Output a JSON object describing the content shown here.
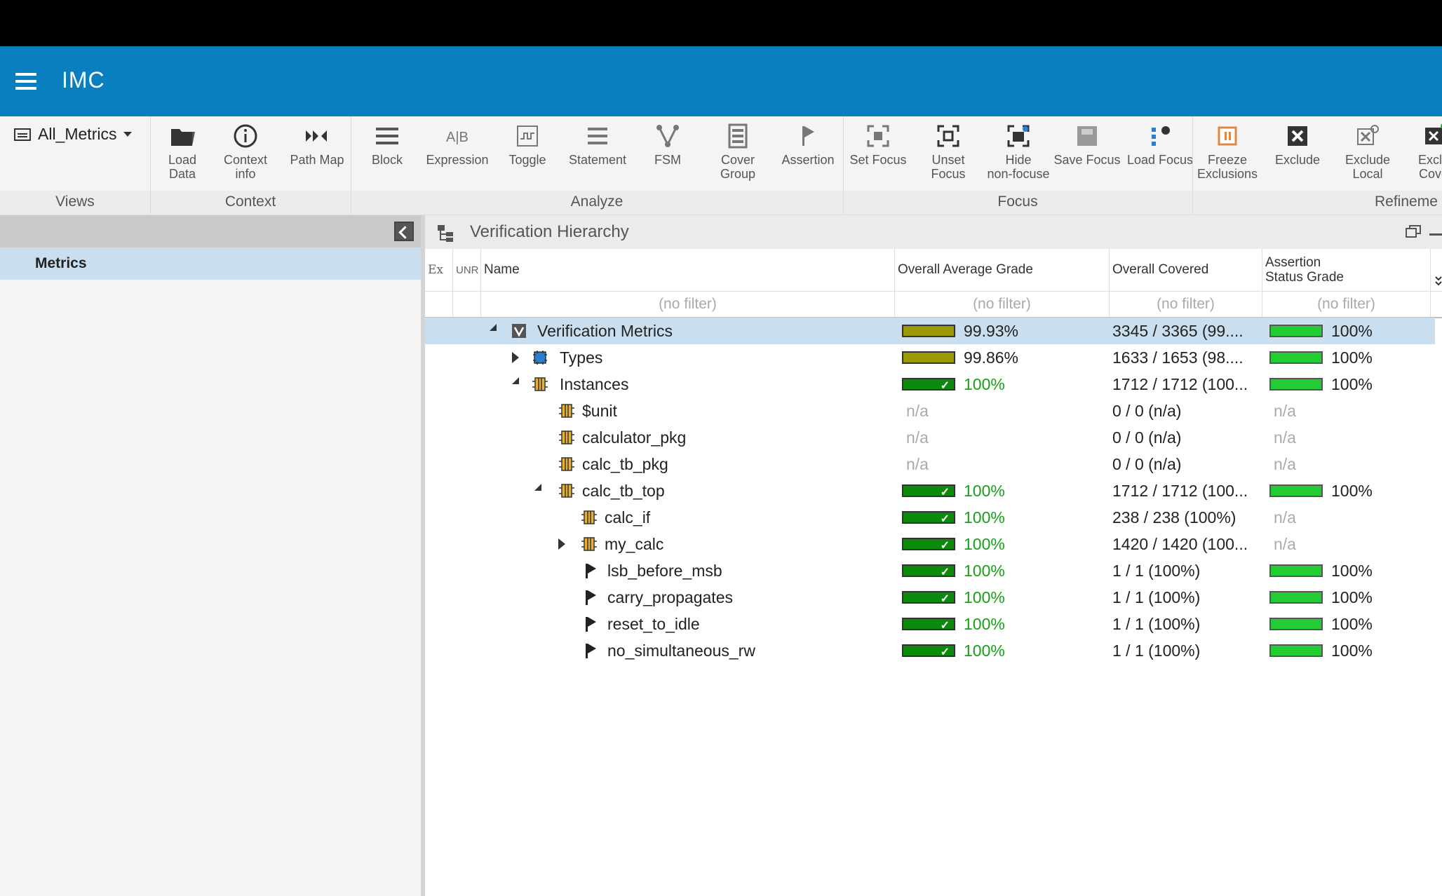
{
  "app": {
    "title": "IMC"
  },
  "ribbon": {
    "views_select": "All_Metrics",
    "buttons": {
      "load_data": "Load\nData",
      "context_info": "Context\ninfo",
      "path_map": "Path Map",
      "block": "Block",
      "expression": "Expression",
      "toggle": "Toggle",
      "statement": "Statement",
      "fsm": "FSM",
      "cover_group": "Cover\nGroup",
      "assertion": "Assertion",
      "set_focus": "Set Focus",
      "unset_focus": "Unset\nFocus",
      "hide_non_focused": "Hide\nnon-focuse",
      "save_focus": "Save Focus",
      "load_focus": "Load Focus",
      "freeze_exclusions": "Freeze\nExclusions",
      "exclude": "Exclude",
      "exclude_local": "Exclude\nLocal",
      "exclude_cover": "Exclu\nCove"
    },
    "groups": {
      "views": "Views",
      "context": "Context",
      "analyze": "Analyze",
      "focus": "Focus",
      "refinement": "Refineme"
    }
  },
  "left_panel": {
    "item": "Metrics"
  },
  "main_panel": {
    "title": "Verification Hierarchy",
    "columns": {
      "ex": "Ex",
      "unr": "UNR",
      "name": "Name",
      "avg_grade": "Overall Average Grade",
      "covered": "Overall Covered",
      "assert_grade": "Assertion\nStatus Grade"
    },
    "filter_placeholder": "(no filter)",
    "rows": [
      {
        "name": "Verification Metrics",
        "grade": "99.93%",
        "covered": "3345 / 3365 (99....",
        "assert": "100%"
      },
      {
        "name": "Types",
        "grade": "99.86%",
        "covered": "1633 / 1653 (98....",
        "assert": "100%"
      },
      {
        "name": "Instances",
        "grade": "100%",
        "covered": "1712 / 1712 (100...",
        "assert": "100%"
      },
      {
        "name": "$unit",
        "grade": "n/a",
        "covered": "0 / 0 (n/a)",
        "assert": "n/a"
      },
      {
        "name": "calculator_pkg",
        "grade": "n/a",
        "covered": "0 / 0 (n/a)",
        "assert": "n/a"
      },
      {
        "name": "calc_tb_pkg",
        "grade": "n/a",
        "covered": "0 / 0 (n/a)",
        "assert": "n/a"
      },
      {
        "name": "calc_tb_top",
        "grade": "100%",
        "covered": "1712 / 1712 (100...",
        "assert": "100%"
      },
      {
        "name": "calc_if",
        "grade": "100%",
        "covered": "238 / 238 (100%)",
        "assert": "n/a"
      },
      {
        "name": "my_calc",
        "grade": "100%",
        "covered": "1420 / 1420 (100...",
        "assert": "n/a"
      },
      {
        "name": "lsb_before_msb",
        "grade": "100%",
        "covered": "1 / 1 (100%)",
        "assert": "100%"
      },
      {
        "name": "carry_propagates",
        "grade": "100%",
        "covered": "1 / 1 (100%)",
        "assert": "100%"
      },
      {
        "name": "reset_to_idle",
        "grade": "100%",
        "covered": "1 / 1 (100%)",
        "assert": "100%"
      },
      {
        "name": "no_simultaneous_rw",
        "grade": "100%",
        "covered": "1 / 1 (100%)",
        "assert": "100%"
      }
    ]
  },
  "colors": {
    "appbar": "#0a7fbf",
    "selection": "#c9dfef",
    "olive_bar": "#9a9a00",
    "green_bar": "#0b8a0b",
    "bright_bar": "#22cc33"
  }
}
